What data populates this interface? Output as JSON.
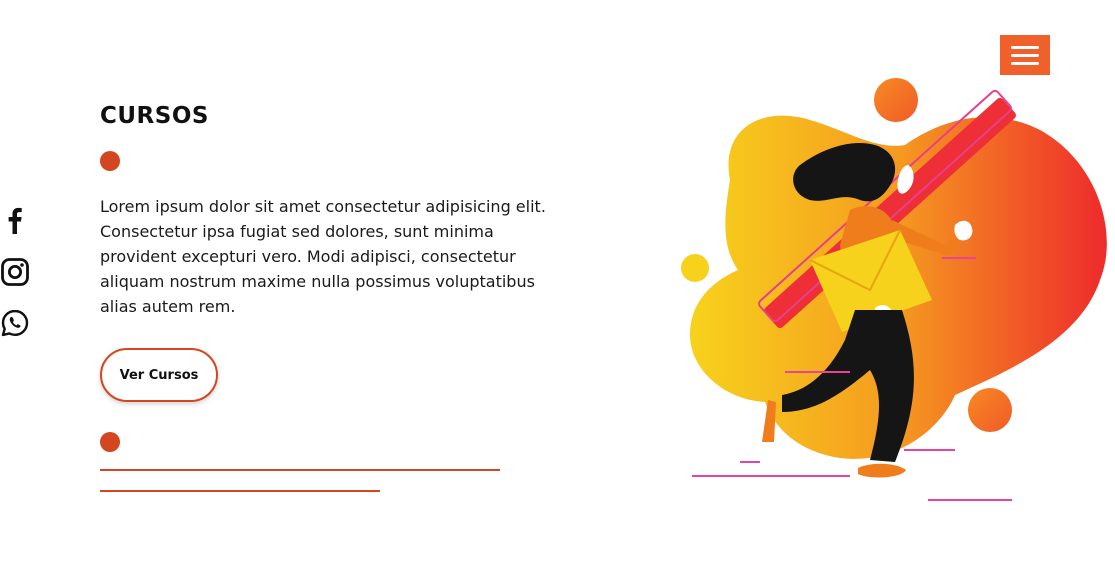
{
  "header": {
    "menu_icon": "hamburger-icon",
    "menu_color": "#f0602a"
  },
  "social": [
    {
      "name": "facebook",
      "icon": "facebook-icon"
    },
    {
      "name": "instagram",
      "icon": "instagram-icon"
    },
    {
      "name": "whatsapp",
      "icon": "whatsapp-icon"
    }
  ],
  "section": {
    "title": "CURSOS",
    "description": "Lorem ipsum dolor sit amet consectetur adipisicing elit. Consectetur ipsa fugiat sed dolores, sunt minima provident excepturi vero. Modi adipisci, consectetur aliquam nostrum maxime nulla possimus voluptatibus alias autem rem.",
    "cta_label": "Ver Cursos",
    "accent_color": "#d4461f"
  },
  "illustration": {
    "subject": "woman running with envelope and pencil"
  }
}
